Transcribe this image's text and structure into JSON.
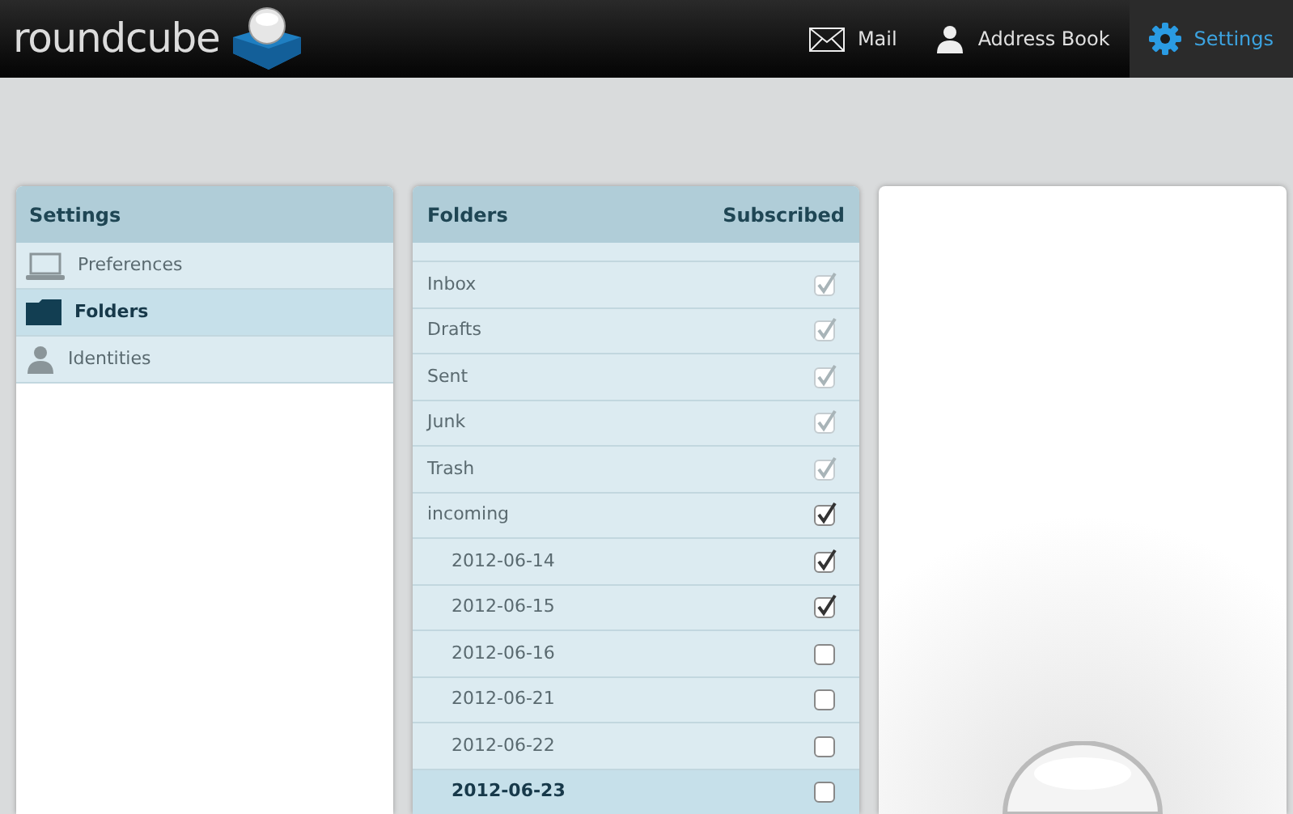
{
  "header": {
    "logo": "roundcube",
    "nav": [
      {
        "label": "Mail",
        "kind": "mail",
        "selected": false
      },
      {
        "label": "Address Book",
        "kind": "person",
        "selected": false
      },
      {
        "label": "Settings",
        "kind": "gear",
        "selected": true
      }
    ]
  },
  "settings_panel": {
    "title": "Settings",
    "items": [
      {
        "label": "Preferences",
        "kind": "laptop",
        "selected": false
      },
      {
        "label": "Folders",
        "kind": "folder",
        "selected": true
      },
      {
        "label": "Identities",
        "kind": "person",
        "selected": false
      }
    ]
  },
  "folders_panel": {
    "columns": [
      "Folders",
      "Subscribed"
    ],
    "folders": [
      {
        "name": "Inbox",
        "subscribed": true,
        "disabled": true,
        "selected": false
      },
      {
        "name": "Drafts",
        "subscribed": true,
        "disabled": true,
        "selected": false
      },
      {
        "name": "Sent",
        "subscribed": true,
        "disabled": true,
        "selected": false
      },
      {
        "name": "Junk",
        "subscribed": true,
        "disabled": true,
        "selected": false
      },
      {
        "name": "Trash",
        "subscribed": true,
        "disabled": true,
        "selected": false
      },
      {
        "name": "incoming",
        "subscribed": true,
        "disabled": false,
        "selected": false,
        "children": [
          {
            "name": "2012-06-14",
            "subscribed": true,
            "disabled": false,
            "selected": false
          },
          {
            "name": "2012-06-15",
            "subscribed": true,
            "disabled": false,
            "selected": false
          },
          {
            "name": "2012-06-16",
            "subscribed": false,
            "disabled": false,
            "selected": false
          },
          {
            "name": "2012-06-21",
            "subscribed": false,
            "disabled": false,
            "selected": false
          },
          {
            "name": "2012-06-22",
            "subscribed": false,
            "disabled": false,
            "selected": false
          },
          {
            "name": "2012-06-23",
            "subscribed": false,
            "disabled": false,
            "selected": true
          }
        ]
      }
    ]
  }
}
